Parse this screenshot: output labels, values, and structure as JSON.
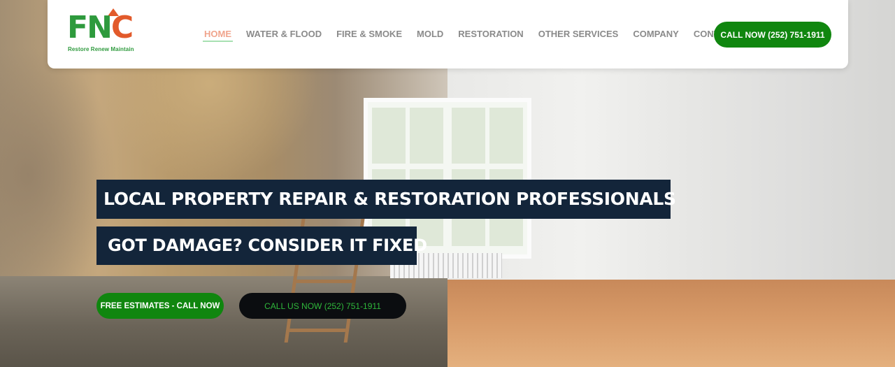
{
  "header": {
    "logo": {
      "letters": [
        "F",
        "N",
        "C"
      ],
      "tagline": "Restore Renew Maintain"
    },
    "nav": [
      {
        "label": "HOME",
        "active": true
      },
      {
        "label": "WATER & FLOOD"
      },
      {
        "label": "FIRE & SMOKE"
      },
      {
        "label": "MOLD"
      },
      {
        "label": "RESTORATION"
      },
      {
        "label": "OTHER SERVICES"
      },
      {
        "label": "COMPANY"
      },
      {
        "label": "CONTACT"
      }
    ],
    "call_button": "CALL NOW (252) 751-1911"
  },
  "hero": {
    "headline": "LOCAL PROPERTY REPAIR & RESTORATION PROFESSIONALS",
    "subheadline": "GOT DAMAGE? CONSIDER IT FIXED",
    "estimate_button": "FREE ESTIMATES - CALL NOW",
    "call_us_button": "CALL US NOW (252) 751-1911"
  },
  "colors": {
    "brand_green": "#10860f",
    "logo_green": "#2e9a3d",
    "logo_orange": "#e25a2b",
    "headline_bg": "#13253a",
    "active_nav": "#f0a48c",
    "nav_text": "#8a8a8a"
  }
}
